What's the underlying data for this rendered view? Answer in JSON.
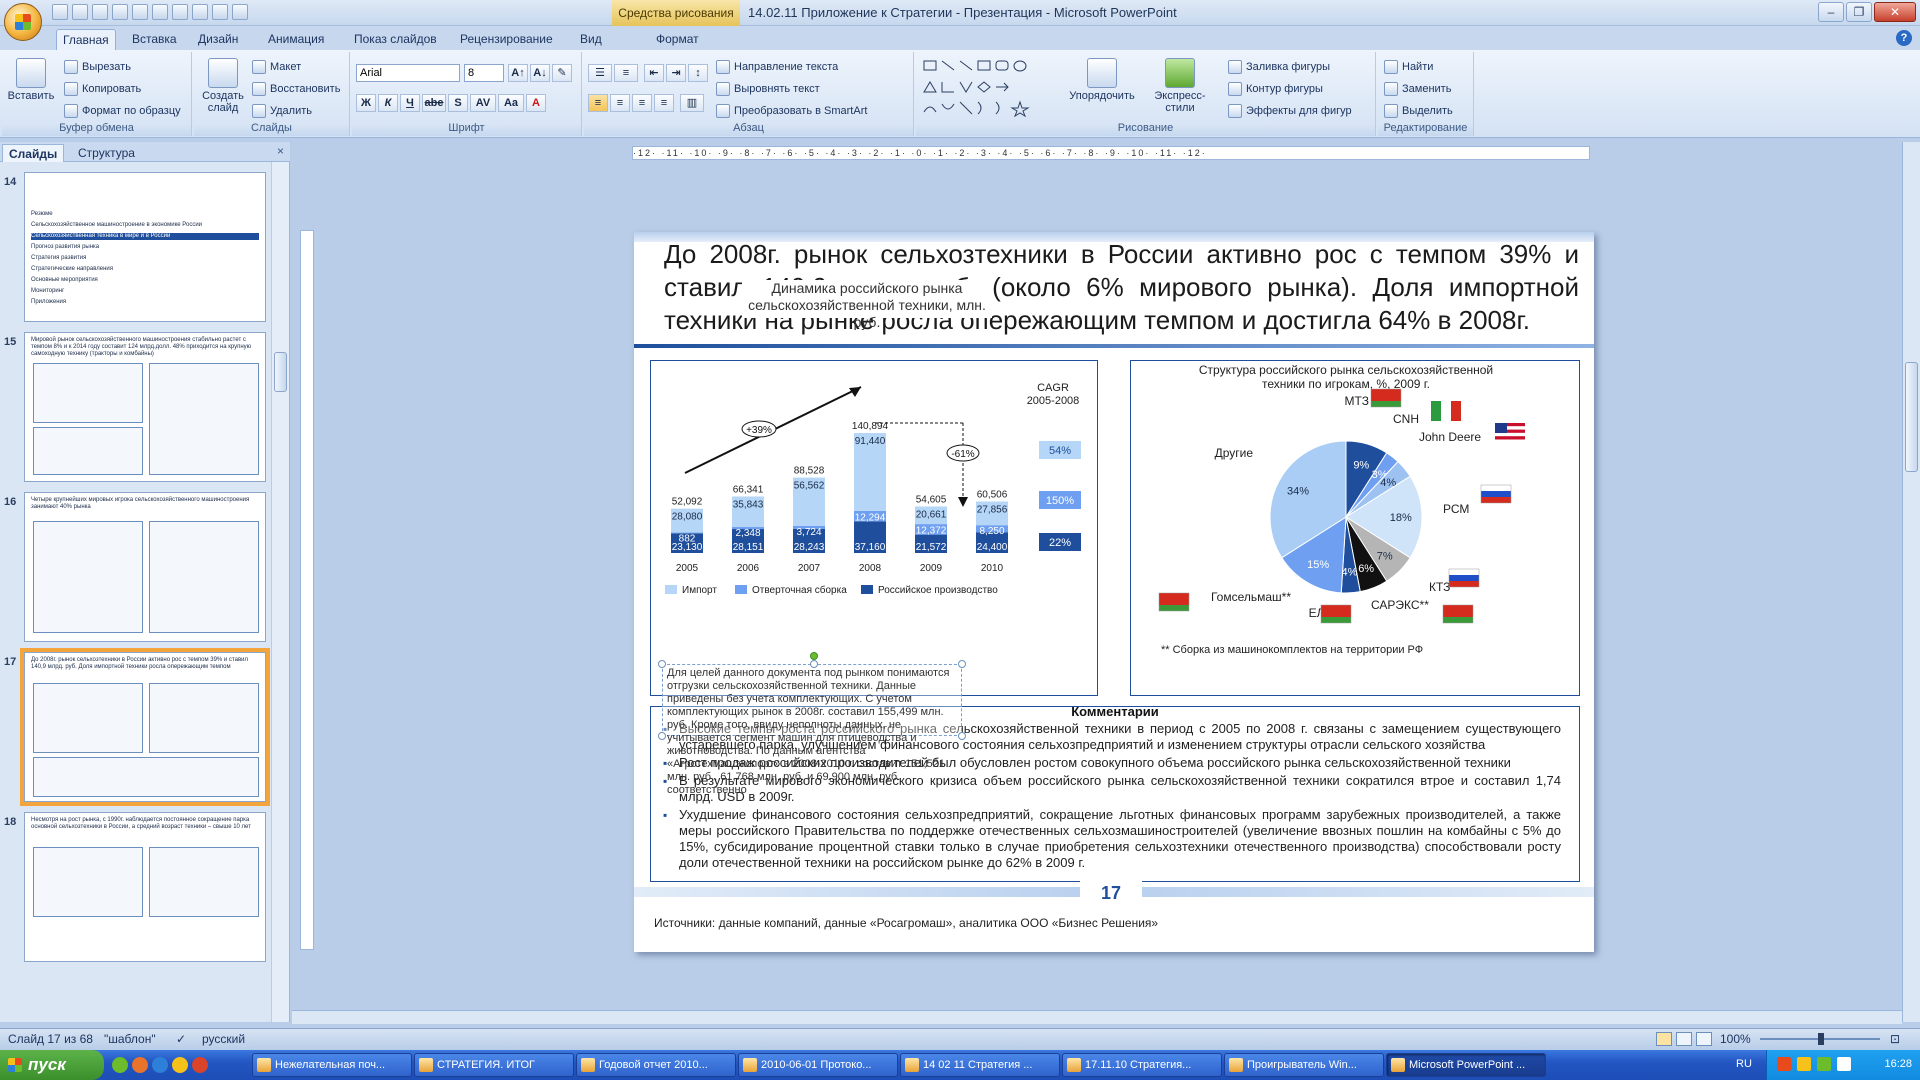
{
  "window": {
    "title": "14.02.11 Приложение к Стратегии - Презентация - Microsoft PowerPoint",
    "context_tab": "Средства рисования",
    "controls": [
      "–",
      "❐",
      "✕"
    ]
  },
  "ribbon": {
    "tabs": [
      "Главная",
      "Вставка",
      "Дизайн",
      "Анимация",
      "Показ слайдов",
      "Рецензирование",
      "Вид",
      "Формат"
    ],
    "active_tab": "Главная",
    "clipboard": {
      "paste": "Вставить",
      "cut": "Вырезать",
      "copy": "Копировать",
      "format_painter": "Формат по образцу",
      "label": "Буфер обмена"
    },
    "slides": {
      "new_slide": "Создать слайд",
      "layout": "Макет",
      "reset": "Восстановить",
      "delete": "Удалить",
      "label": "Слайды"
    },
    "font": {
      "family": "Arial",
      "size": "8",
      "label": "Шрифт",
      "bold": "Ж",
      "italic": "К",
      "underline": "Ч",
      "strike": "abe",
      "shadow": "S",
      "spacing": "AV",
      "case": "Aa",
      "color": "A"
    },
    "paragraph": {
      "text_direction": "Направление текста",
      "align_text": "Выровнять текст",
      "smartart": "Преобразовать в SmartArt",
      "label": "Абзац"
    },
    "drawing": {
      "arrange": "Упорядочить",
      "quick_styles": "Экспресс-стили",
      "fill": "Заливка фигуры",
      "outline": "Контур фигуры",
      "effects": "Эффекты для фигур",
      "label": "Рисование"
    },
    "editing": {
      "find": "Найти",
      "replace": "Заменить",
      "select": "Выделить",
      "label": "Редактирование"
    }
  },
  "pane": {
    "tabs": [
      "Слайды",
      "Структура"
    ],
    "close": "×",
    "thumbnails": [
      {
        "num": "14",
        "title": "Резюме"
      },
      {
        "num": "15",
        "title": "Мировой рынок сельскохозяйственного машиностроения стабильно растет с темпом 8% и к 2014 году составит 124 млрд.долл. 48% приходится на крупную самоходную технику (тракторы и комбайны)"
      },
      {
        "num": "16",
        "title": "Четыре крупнейших мировых игрока сельскохозяйственного машиностроения занимают 40% рынка"
      },
      {
        "num": "17",
        "title": "До 2008г. рынок сельхозтехники в России активно рос с темпом 39% и ставил 140,9 млрд. руб. Доля импортной техники росла опережающим темпом"
      },
      {
        "num": "18",
        "title": "Несмотря на рост рынка, с 1990г. наблюдается постоянное сокращение парка основной сельхозтехники в России, а средний возраст техники – свыше 10 лет"
      }
    ],
    "toc_items": [
      "Резюме",
      "Сельскохозяйственное машиностроение в экономике России",
      "Сельскохозяйственная техника в мире и в России",
      "Прогноз развития рынка",
      "Стратегия развития",
      "Стратегические направления",
      "Основные мероприятия",
      "Мониторинг",
      "Приложения"
    ]
  },
  "ruler": {
    "marks": "·12·  ·11·  ·10·  ·9·  ·8·  ·7·  ·6·  ·5·  ·4·  ·3·  ·2·  ·1·  ·0·  ·1·  ·2·  ·3·  ·4·  ·5·  ·6·  ·7·  ·8·  ·9·  ·10·  ·11·  ·12·"
  },
  "slide": {
    "title": "До 2008г. рынок сельхозтехники в России активно рос с темпом 39% и ставил 140,9 млрд. руб. (около 6% мирового рынка). Доля импортной техники на рынке росла опережающим темпом и достигла 64% в 2008г.",
    "overlay_caption": "Динамика российского рынка сельскохозяйственной техники, млн. руб.",
    "number": "17",
    "sources": "Источники:  данные компаний, данные «Росагромаш», аналитика ООО «Бизнес Решения»",
    "comments_title": "Комментарии",
    "comments": [
      "Высокие темпы роста российского рынка сельскохозяйственной техники в период с 2005 по 2008 г. связаны с замещением  существующего устаревшего парка, улучшением финансового состояния  сельхозпредприятий и изменением  структуры отрасли сельского хозяйства",
      "Рост продаж российских производителей был обусловлен  ростом совокупного объема российского рынка сельскохозяйственной техники",
      "В результате мирового экономического кризиса объем российского рынка сельскохозяйственной техники сократился втрое и составил 1,74 млрд. USD в 2009г.",
      "Ухудшение финансового состояния сельхозпредприятий, сокращение льготных финансовых программ зарубежных производителей, а также меры российского Правительства по поддержке отечественных сельхозмашиностроителей (увеличение ввозных пошлин на комбайны с 5% до 15%, субсидирование процентной ставки только в случае приобретения сельхозтехники отечественного производства) способствовали росту доли отечественной техники  на российском рынке до 62% в 2009 г."
    ],
    "footnote": "Для целей данного документа под рынком понимаются отгрузки сельскохозяйственной техники. Данные приведены без учета комплектующих. С учетом комплектующих рынок в 2008г. составил 155,499 млн. руб. Кроме того, ввиду неполноты данных, не учитывается сегмент машин для птицеводства и животноводства. По данным агентства «Агротехмашэкспорт» в 2008-2010 г. составит 151,521 млн. руб., 61,768 млн. руб. и 69,900 млн. руб. соответственно"
  },
  "chart_data": [
    {
      "type": "bar",
      "stacked": true,
      "categories": [
        "2005",
        "2006",
        "2007",
        "2008",
        "2009",
        "2010"
      ],
      "series": [
        {
          "name": "Российское производство",
          "values": [
            23130,
            28151,
            28243,
            37160,
            21572,
            24400
          ],
          "color": "#1f4f9c"
        },
        {
          "name": "Отверточная сборка",
          "values": [
            882,
            2348,
            3724,
            12294,
            12372,
            8250
          ],
          "color": "#6e9ff0"
        },
        {
          "name": "Импорт",
          "values": [
            28080,
            35843,
            56562,
            91440,
            20661,
            27856
          ],
          "color": "#b5d6f7"
        }
      ],
      "totals": [
        52092,
        66341,
        88528,
        140894,
        54605,
        60506
      ],
      "total_labels": [
        "52,092",
        "66,341",
        "88,528",
        "140,894",
        "54,605",
        "60,506"
      ],
      "segment_labels": [
        [
          "23,130",
          "882",
          "28,080"
        ],
        [
          "28,151",
          "2,348",
          "35,843"
        ],
        [
          "28,243",
          "3,724",
          "56,562"
        ],
        [
          "37,160",
          "12,294",
          "91,440"
        ],
        [
          "21,572",
          "12,372",
          "20,661"
        ],
        [
          "24,400",
          "8,250",
          "27,856"
        ]
      ],
      "annotations": [
        "+39%",
        "-61%"
      ],
      "cagr_title": "CAGR 2005-2008",
      "cagr": [
        {
          "series": "Импорт",
          "value": "54%"
        },
        {
          "series": "Отверточная сборка",
          "value": "150%"
        },
        {
          "series": "Российское производство",
          "value": "22%"
        }
      ],
      "legend": [
        "Импорт",
        "Отверточная сборка",
        "Российское производство"
      ],
      "legend_position": "bottom"
    },
    {
      "type": "pie",
      "title": "Структура российского рынка сельскохозяйственной техники по игрокам, %, 2009 г.",
      "slices": [
        {
          "label": "МТЗ",
          "value": 9,
          "color": "#1f4f9c"
        },
        {
          "label": "CNH",
          "value": 3,
          "color": "#6e9ff0"
        },
        {
          "label": "John Deere",
          "value": 4,
          "color": "#9dc2f2"
        },
        {
          "label": "РСМ",
          "value": 18,
          "color": "#cfe3f9"
        },
        {
          "label": "САРЭКС**",
          "value": 7,
          "color": "#b5b5b5"
        },
        {
          "label": "КТЗ",
          "value": 6,
          "color": "#111111"
        },
        {
          "label": "ЕЛАЗ**",
          "value": 4,
          "color": "#1f4f9c"
        },
        {
          "label": "Гомсельмаш**",
          "value": 15,
          "color": "#6e9ff0"
        },
        {
          "label": "Другие",
          "value": 34,
          "color": "#a9cdf5"
        }
      ],
      "value_labels": [
        "9%",
        "3%",
        "4%",
        "18%",
        "7%",
        "6%",
        "4%",
        "15%",
        "34%"
      ],
      "footnote": "** Сборка из машинокомплектов на территории РФ"
    }
  ],
  "status": {
    "slide": "Слайд 17 из 68",
    "theme": "\"шаблон\"",
    "lang": "русский",
    "zoom": "100%"
  },
  "taskbar": {
    "start": "пуск",
    "tasks": [
      "Нежелательная поч...",
      "СТРАТЕГИЯ. ИТОГ",
      "Годовой отчет 2010...",
      "2010-06-01 Протоко...",
      "14 02 11 Стратегия ...",
      "17.11.10 Стратегия...",
      "Проигрыватель Win...",
      "Microsoft PowerPoint ..."
    ],
    "active_task": "Microsoft PowerPoint ...",
    "lang": "RU",
    "time": "16:28"
  }
}
